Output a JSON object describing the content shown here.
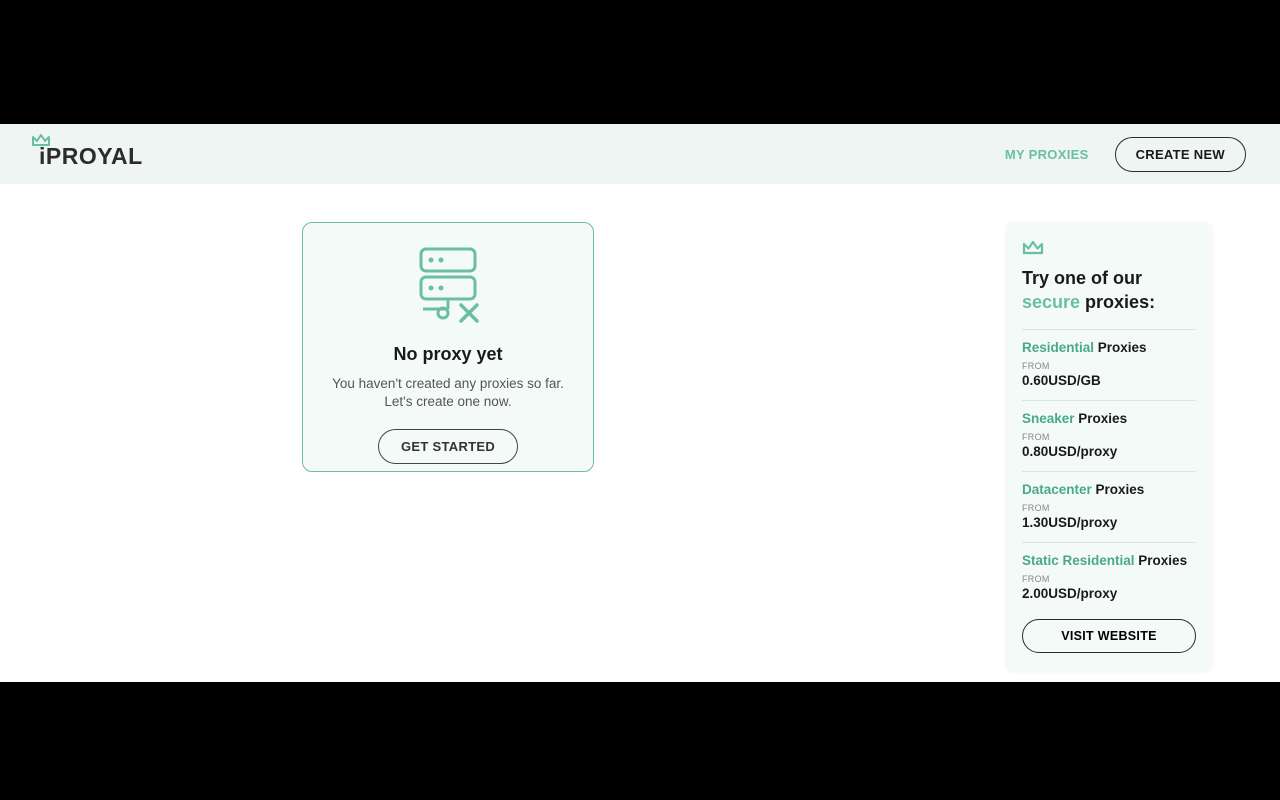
{
  "header": {
    "logo_text": "iPROYAL",
    "nav_my_proxies": "MY PROXIES",
    "nav_create_new": "CREATE NEW"
  },
  "empty": {
    "title": "No proxy yet",
    "subtitle": "You haven't created any proxies so far. Let's create one now.",
    "button": "GET STARTED"
  },
  "sidebar": {
    "title_prefix": "Try one of our ",
    "title_accent": "secure",
    "title_suffix": " proxies:",
    "from_label": "FROM",
    "plans": [
      {
        "accent": "Residential",
        "rest": " Proxies",
        "price": "0.60USD/GB"
      },
      {
        "accent": "Sneaker",
        "rest": " Proxies",
        "price": "0.80USD/proxy"
      },
      {
        "accent": "Datacenter",
        "rest": " Proxies",
        "price": "1.30USD/proxy"
      },
      {
        "accent": "Static Residential",
        "rest": " Proxies",
        "price": "2.00USD/proxy"
      }
    ],
    "visit_button": "VISIT WEBSITE"
  },
  "colors": {
    "accent": "#6bbfa1"
  }
}
